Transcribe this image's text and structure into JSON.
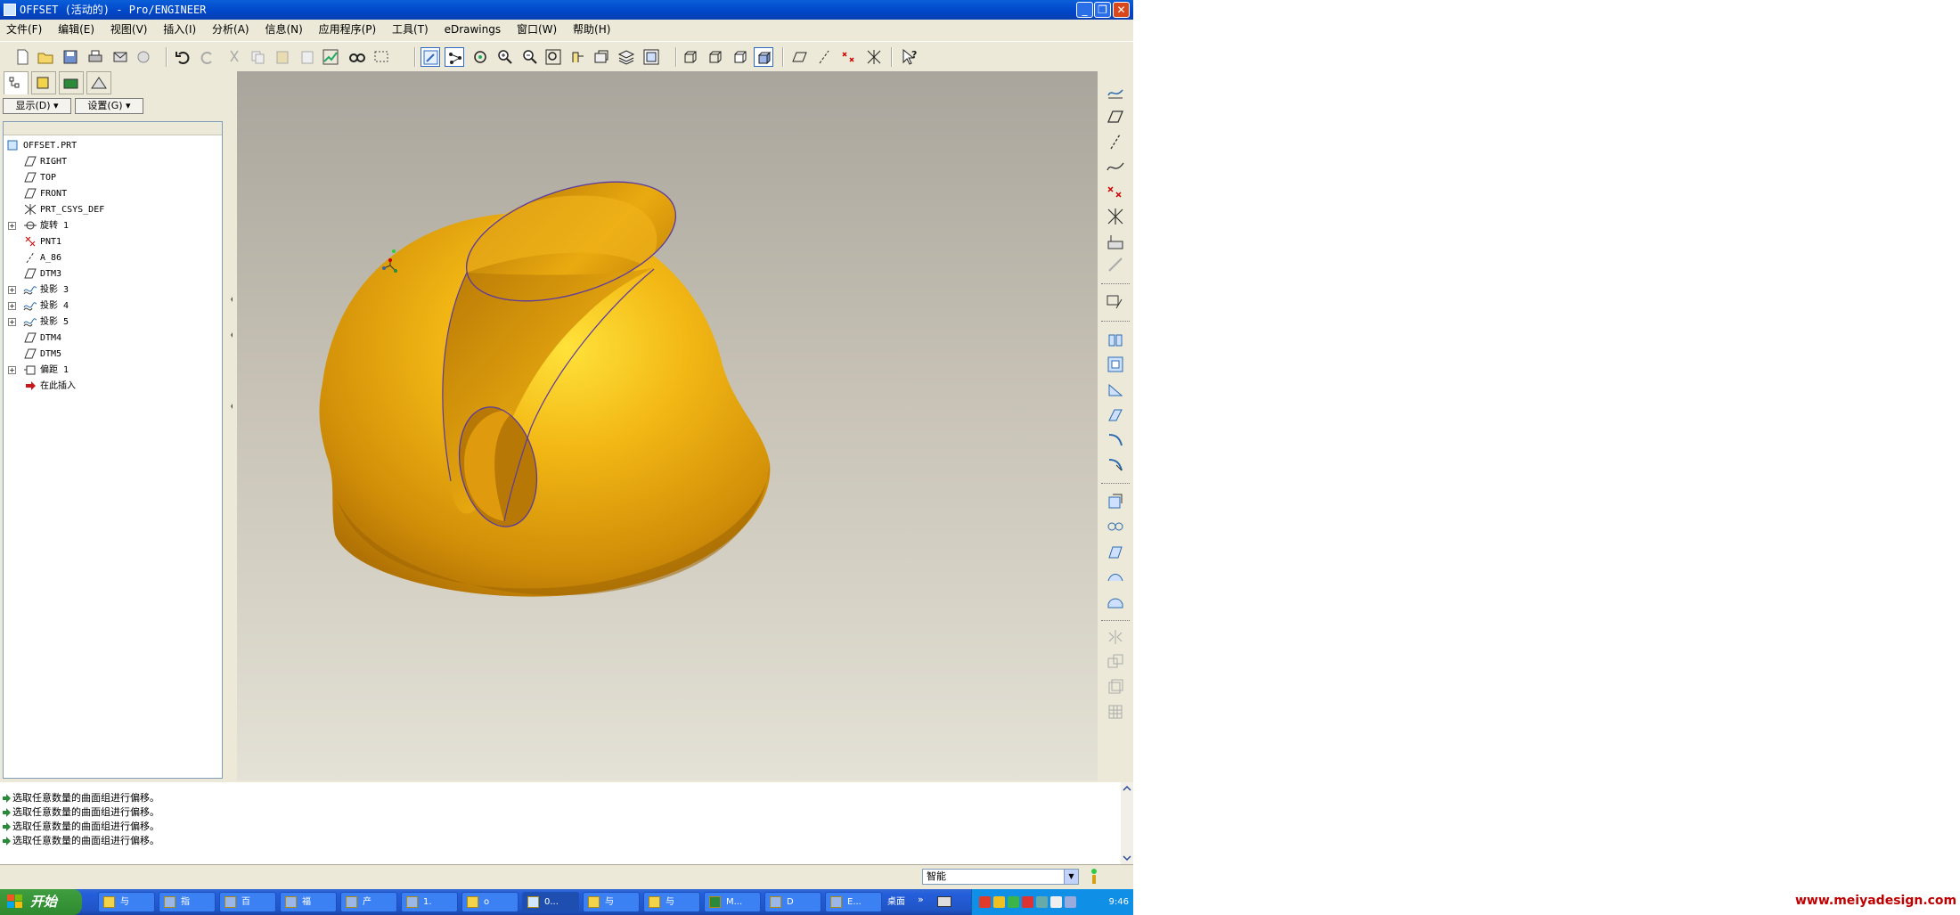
{
  "window": {
    "title": "OFFSET (活动的) - Pro/ENGINEER"
  },
  "menu": [
    "文件(F)",
    "编辑(E)",
    "视图(V)",
    "插入(I)",
    "分析(A)",
    "信息(N)",
    "应用程序(P)",
    "工具(T)",
    "eDrawings",
    "窗口(W)",
    "帮助(H)"
  ],
  "panel": {
    "show_label": "显示(D)",
    "settings_label": "设置(G)"
  },
  "tree": {
    "root": "OFFSET.PRT",
    "items": [
      "RIGHT",
      "TOP",
      "FRONT",
      "PRT_CSYS_DEF",
      "旋转 1",
      "PNT1",
      "A_86",
      "DTM3",
      "投影 3",
      "投影 4",
      "投影 5",
      "DTM4",
      "DTM5",
      "偏距 1",
      "在此插入"
    ]
  },
  "messages": [
    "选取任意数量的曲面组进行偏移。",
    "选取任意数量的曲面组进行偏移。",
    "选取任意数量的曲面组进行偏移。",
    "选取任意数量的曲面组进行偏移。"
  ],
  "status": {
    "filter_value": "智能"
  },
  "taskbar": {
    "start_label": "开始",
    "tasks": [
      "与",
      "指",
      "百",
      "福",
      "产",
      "1.",
      "o",
      "0...",
      "与",
      "与",
      "M...",
      "D",
      "E..."
    ],
    "desktop_label": "桌面",
    "clock": "9:46"
  },
  "watermark": "www.meiyadesign.com",
  "colors": {
    "titlebar": "#0a5fd8",
    "part": "#e9a80a",
    "taskbar": "#245edb",
    "watermark": "#c00000"
  }
}
